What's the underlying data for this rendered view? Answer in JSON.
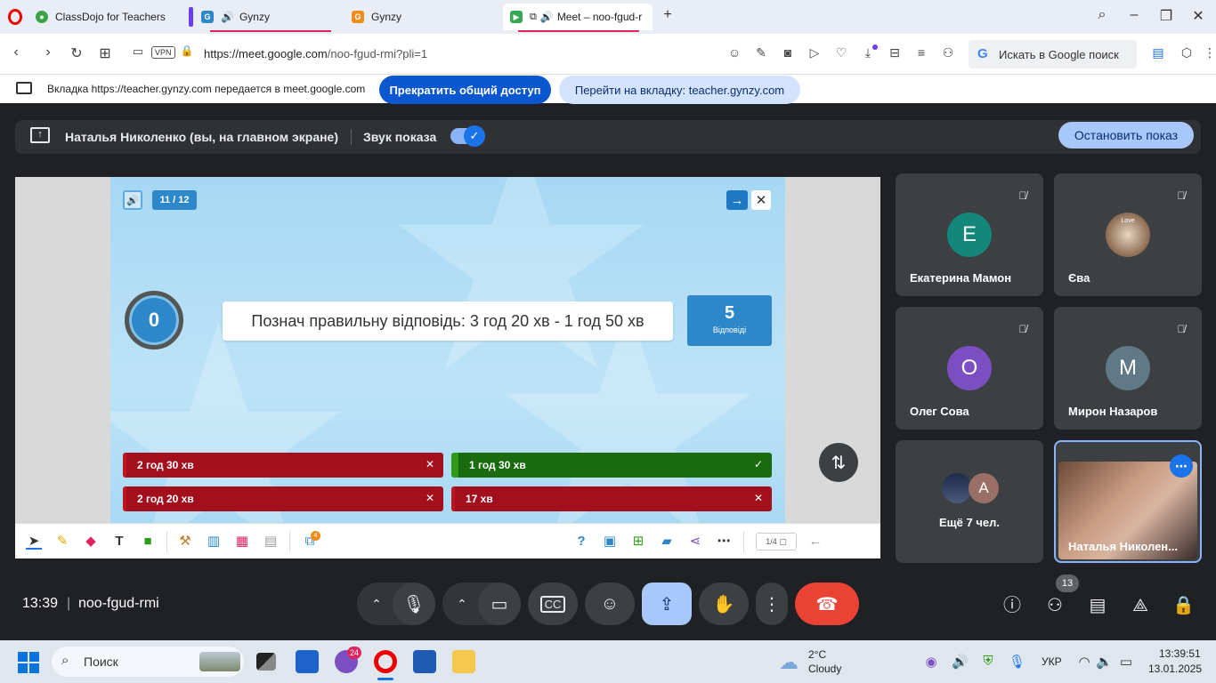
{
  "browser": {
    "tabs": [
      {
        "title": "ClassDojo for Teachers"
      },
      {
        "title": "Gynzy"
      },
      {
        "title": "Gynzy"
      },
      {
        "title": "Meet – noo-fgud-r"
      }
    ],
    "url_host": "https://meet.google.com",
    "url_path": "/noo-fgud-rmi?pli=1",
    "vpn_label": "VPN",
    "search_placeholder": "Искать в Google поиск"
  },
  "sharebar": {
    "notice": "Вкладка https://teacher.gynzy.com передается в meet.google.com",
    "stop_label": "Прекратить общий доступ",
    "goto_label": "Перейти на вкладку: teacher.gynzy.com"
  },
  "presenting": {
    "name": "Наталья Николенко (вы, на главном экране)",
    "sound_label": "Звук показа",
    "stop_label": "Остановить показ"
  },
  "slide": {
    "progress": "11 / 12",
    "score": "0",
    "question": "Познач правильну відповідь: 3 год 20 хв - 1 год 50 хв",
    "answers_count": "5",
    "answers_label": "Відповіді",
    "answers": [
      {
        "text": "2 год 30 хв",
        "correct": false
      },
      {
        "text": "1 год 30 хв",
        "correct": true
      },
      {
        "text": "2 год 20 хв",
        "correct": false
      },
      {
        "text": "17 хв",
        "correct": false
      }
    ],
    "page_indicator": "1/4",
    "toolbar_badge": "4"
  },
  "participants": [
    {
      "name": "Екатерина Мамон",
      "initial": "E",
      "color": "#12877a"
    },
    {
      "name": "Єва",
      "initial": "Love",
      "color": "#b79b85"
    },
    {
      "name": "Олег Сова",
      "initial": "O",
      "color": "#7b4fc2"
    },
    {
      "name": "Мирон Назаров",
      "initial": "M",
      "color": "#5f7a86"
    },
    {
      "name": "Ещё 7 чел.",
      "initial": "A",
      "color": "#9a7066"
    },
    {
      "name": "Наталья Николен...",
      "initial": "",
      "color": ""
    }
  ],
  "controls": {
    "time": "13:39",
    "separator": "|",
    "meeting_code": "noo-fgud-rmi",
    "people_count": "13"
  },
  "taskbar": {
    "search_label": "Поиск",
    "viber_badge": "24",
    "temperature": "2°C",
    "weather": "Cloudy",
    "language": "УКР",
    "time": "13:39:51",
    "date": "13.01.2025"
  },
  "colors": {
    "accent": "#1a73e8",
    "end_call": "#ea4335",
    "wrong": "#a30f1c",
    "right": "#1a6b0f"
  }
}
